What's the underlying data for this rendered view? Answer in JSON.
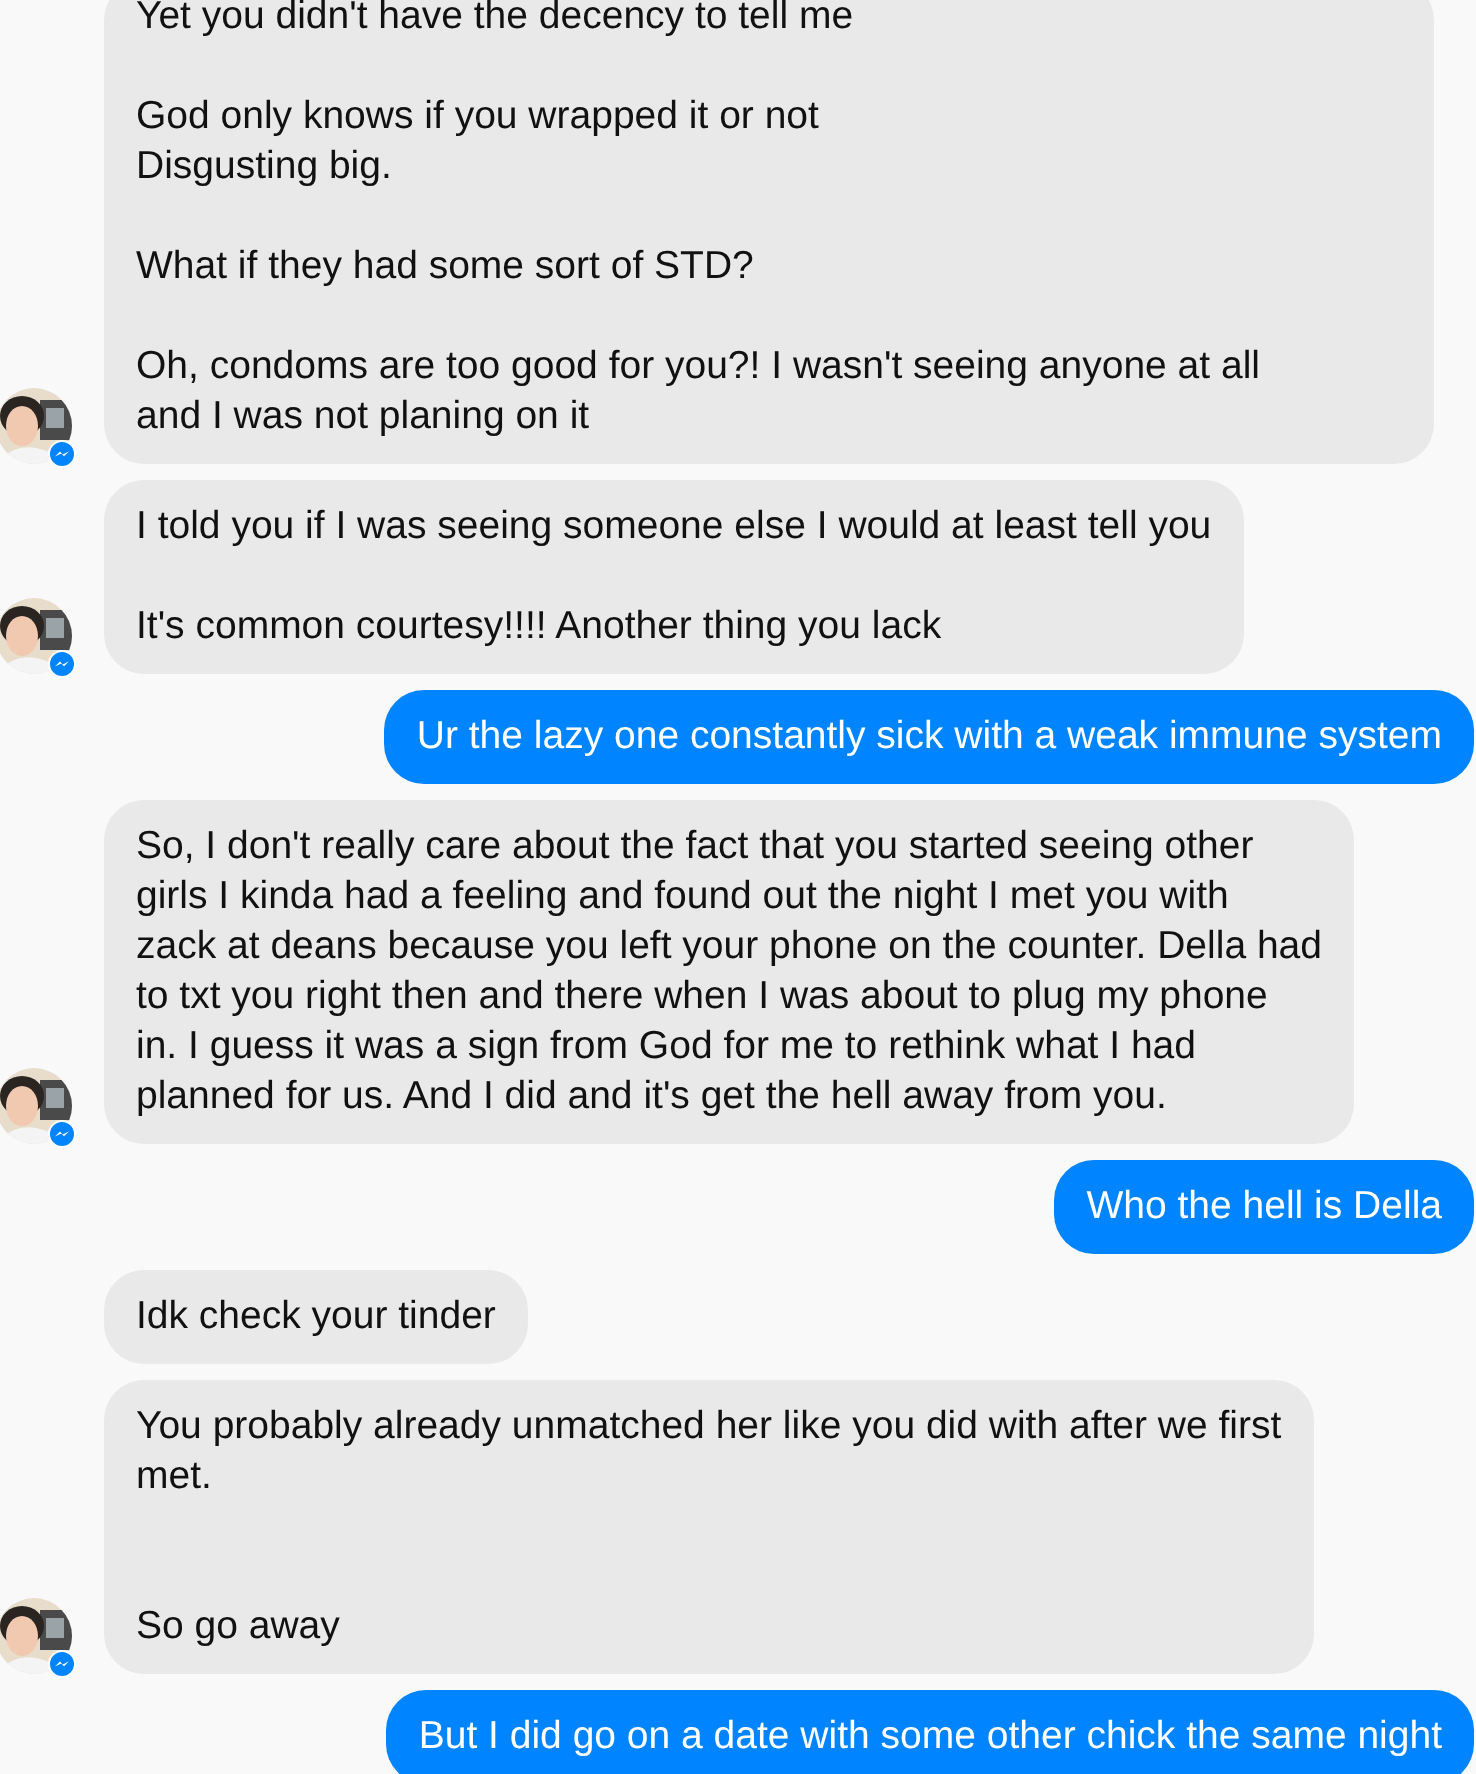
{
  "messages": [
    {
      "kind": "incoming",
      "avatar": true,
      "text": "Yet you didn't have the decency to tell me\n\nGod only knows if you wrapped it or not\nDisgusting big.\n\nWhat if they had some sort of STD?\n\nOh, condoms are too good for you?! I wasn't seeing anyone at all\nand I was not planing on it"
    },
    {
      "kind": "incoming",
      "avatar": true,
      "text": "I told you if I was seeing someone else I would at least tell you\n\nIt's common courtesy!!!! Another thing you lack"
    },
    {
      "kind": "outgoing",
      "avatar": false,
      "text": "Ur the lazy one constantly sick with a weak immune system"
    },
    {
      "kind": "incoming",
      "avatar": true,
      "text": "So, I don't really care about the fact that you started seeing other\ngirls I kinda had a feeling and found out the night I met you with\nzack at deans because you left your phone on the counter. Della had\nto txt you right then and there when I was about to plug my phone\nin. I guess it was a sign from God for me to rethink what I had\nplanned for us. And I did and it's get the hell away from you."
    },
    {
      "kind": "outgoing",
      "avatar": false,
      "text": "Who the hell is Della"
    },
    {
      "kind": "incoming",
      "avatar": false,
      "text": "Idk check your tinder"
    },
    {
      "kind": "incoming",
      "avatar": true,
      "text": "You probably already unmatched her like you did with after we first\nmet.\n\n\nSo go away"
    },
    {
      "kind": "outgoing",
      "avatar": false,
      "text": "But I did go on a date with some other chick the same night"
    }
  ]
}
